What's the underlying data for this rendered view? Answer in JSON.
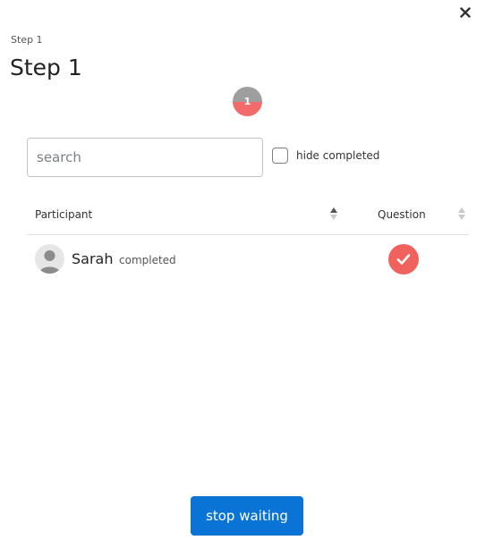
{
  "header": {
    "step_caption": "Step 1",
    "step_title": "Step 1",
    "close_icon": "close-icon"
  },
  "progress": {
    "count": "1",
    "colors": {
      "pending": "#9e9e9e",
      "done": "#f26b6b"
    }
  },
  "filters": {
    "search_placeholder": "search",
    "search_value": "",
    "hide_completed_label": "hide completed",
    "hide_completed_checked": false
  },
  "table": {
    "columns": [
      "Participant",
      "Question"
    ],
    "rows": [
      {
        "name": "Sarah",
        "status": "completed",
        "question_done": true
      }
    ]
  },
  "footer": {
    "stop_label": "stop waiting"
  },
  "colors": {
    "accent": "#0a74d6",
    "check": "#f0625e"
  }
}
